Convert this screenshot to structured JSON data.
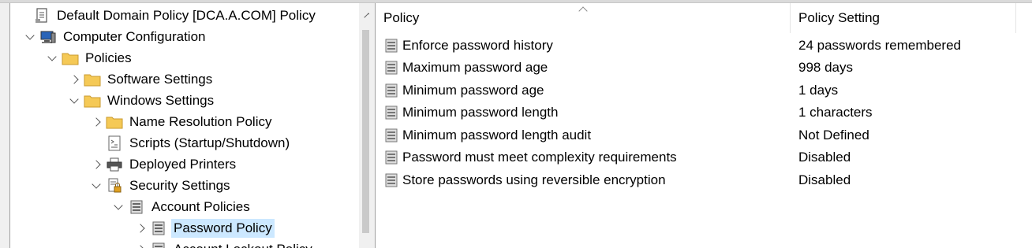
{
  "tree": {
    "items": [
      {
        "label": "Default Domain Policy [DCA.A.COM] Policy",
        "icon": "policy-document-icon",
        "expander": "none"
      },
      {
        "label": "Computer Configuration",
        "icon": "computer-icon",
        "expander": "expanded"
      },
      {
        "label": "Policies",
        "icon": "folder-icon",
        "expander": "expanded"
      },
      {
        "label": "Software Settings",
        "icon": "folder-icon",
        "expander": "collapsed"
      },
      {
        "label": "Windows Settings",
        "icon": "folder-icon",
        "expander": "expanded"
      },
      {
        "label": "Name Resolution Policy",
        "icon": "folder-icon",
        "expander": "collapsed"
      },
      {
        "label": "Scripts (Startup/Shutdown)",
        "icon": "script-icon",
        "expander": "none"
      },
      {
        "label": "Deployed Printers",
        "icon": "printer-icon",
        "expander": "collapsed"
      },
      {
        "label": "Security Settings",
        "icon": "security-settings-icon",
        "expander": "expanded"
      },
      {
        "label": "Account Policies",
        "icon": "policy-book-icon",
        "expander": "expanded"
      },
      {
        "label": "Password Policy",
        "icon": "policy-book-icon",
        "expander": "collapsed",
        "selected": true
      },
      {
        "label": "Account Lockout Policy",
        "icon": "policy-book-icon",
        "expander": "collapsed"
      }
    ]
  },
  "list": {
    "columns": {
      "policy": "Policy",
      "setting": "Policy Setting"
    },
    "rows": [
      {
        "policy": "Enforce password history",
        "setting": "24 passwords remembered"
      },
      {
        "policy": "Maximum password age",
        "setting": "998 days"
      },
      {
        "policy": "Minimum password age",
        "setting": "1 days"
      },
      {
        "policy": "Minimum password length",
        "setting": "1 characters"
      },
      {
        "policy": "Minimum password length audit",
        "setting": "Not Defined"
      },
      {
        "policy": "Password must meet complexity requirements",
        "setting": "Disabled"
      },
      {
        "policy": "Store passwords using reversible encryption",
        "setting": "Disabled"
      }
    ]
  },
  "colors": {
    "selection": "#cce8ff",
    "folder": "#f5c956",
    "scroll_thumb": "#c9c9c9"
  }
}
